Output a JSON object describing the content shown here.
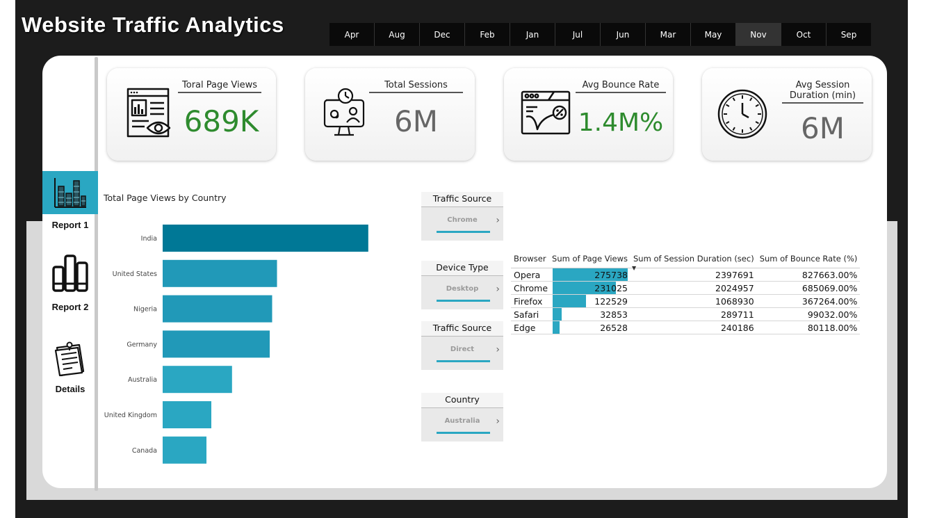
{
  "app": {
    "title": "Website Traffic Analytics"
  },
  "months": {
    "items": [
      "Apr",
      "Aug",
      "Dec",
      "Feb",
      "Jan",
      "Jul",
      "Jun",
      "Mar",
      "May",
      "Nov",
      "Oct",
      "Sep"
    ],
    "selected": "Nov"
  },
  "nav": {
    "report1": "Report 1",
    "report2": "Report 2",
    "details": "Details"
  },
  "kpis": {
    "page_views": {
      "label": "Toral Page Views",
      "value": "689K",
      "color": "#2e8b2e"
    },
    "sessions": {
      "label": "Total Sessions",
      "value": "6M",
      "color": "#666666"
    },
    "bounce": {
      "label": "Avg Bounce Rate",
      "value": "1.4M%",
      "color": "#2e8b2e"
    },
    "duration": {
      "label": "Avg Session Duration (min)",
      "value": "6M",
      "color": "#666666"
    }
  },
  "slicers": [
    {
      "title": "Traffic Source",
      "value": "Chrome"
    },
    {
      "title": "Device Type",
      "value": "Desktop"
    },
    {
      "title": "Traffic Source",
      "value": "Direct"
    },
    {
      "title": "Country",
      "value": "Australia"
    }
  ],
  "table": {
    "headers": [
      "Browser",
      "Sum of Page Views",
      "Sum of Session Duration (sec)",
      "Sum of Bounce Rate (%)"
    ],
    "rows": [
      [
        "Opera",
        "275738",
        "2397691",
        "827663.00%"
      ],
      [
        "Chrome",
        "231025",
        "2024957",
        "685069.00%"
      ],
      [
        "Firefox",
        "122529",
        "1068930",
        "367264.00%"
      ],
      [
        "Safari",
        "32853",
        "289711",
        "99032.00%"
      ],
      [
        "Edge",
        "26528",
        "240186",
        "80118.00%"
      ]
    ],
    "page_view_bar_max": 275738,
    "bar_color": "#2aa7c2"
  },
  "chart_data": {
    "type": "bar",
    "orientation": "horizontal",
    "title": "Total Page Views by Country",
    "categories": [
      "India",
      "United States",
      "Nigeria",
      "Germany",
      "Australia",
      "United Kingdom",
      "Canada"
    ],
    "values": [
      169000,
      94000,
      90000,
      88000,
      57000,
      40000,
      36000
    ],
    "xlim": [
      0,
      180000
    ],
    "colors": [
      "#007896",
      "#2199b8",
      "#2199b8",
      "#2199b8",
      "#2aa7c2",
      "#2aa7c2",
      "#2aa7c2"
    ],
    "grid": false,
    "legend": "none"
  }
}
